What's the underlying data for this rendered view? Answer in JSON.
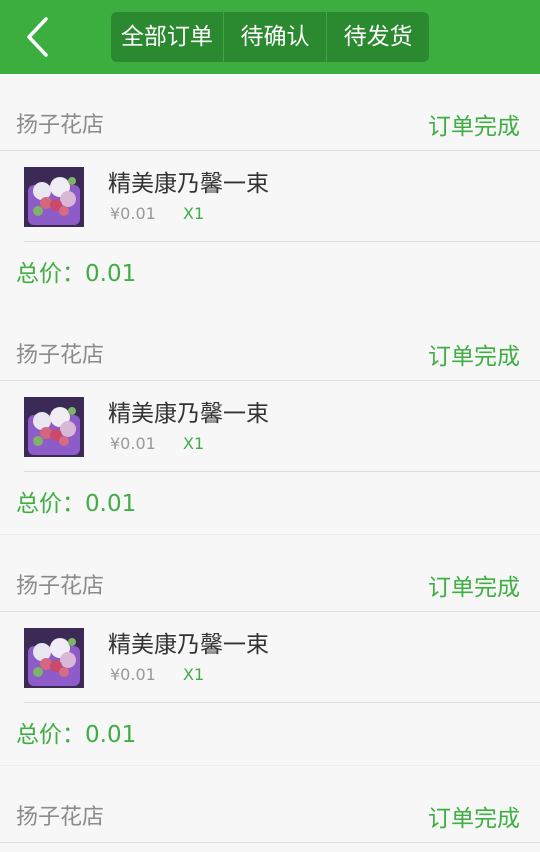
{
  "header": {
    "tabs": [
      "全部订单",
      "待确认",
      "待发货"
    ]
  },
  "orders": [
    {
      "shop": "扬子花店",
      "status": "订单完成",
      "product": "精美康乃馨一束",
      "price": "¥0.01",
      "qty": "X1",
      "total": "总价：0.01"
    },
    {
      "shop": "扬子花店",
      "status": "订单完成",
      "product": "精美康乃馨一束",
      "price": "¥0.01",
      "qty": "X1",
      "total": "总价：0.01"
    },
    {
      "shop": "扬子花店",
      "status": "订单完成",
      "product": "精美康乃馨一束",
      "price": "¥0.01",
      "qty": "X1",
      "total": "总价：0.01"
    },
    {
      "shop": "扬子花店",
      "status": "订单完成"
    }
  ],
  "colors": {
    "brand_green": "#3cae3f",
    "tab_bg": "#2b8a30",
    "status_green": "#3fae43"
  }
}
